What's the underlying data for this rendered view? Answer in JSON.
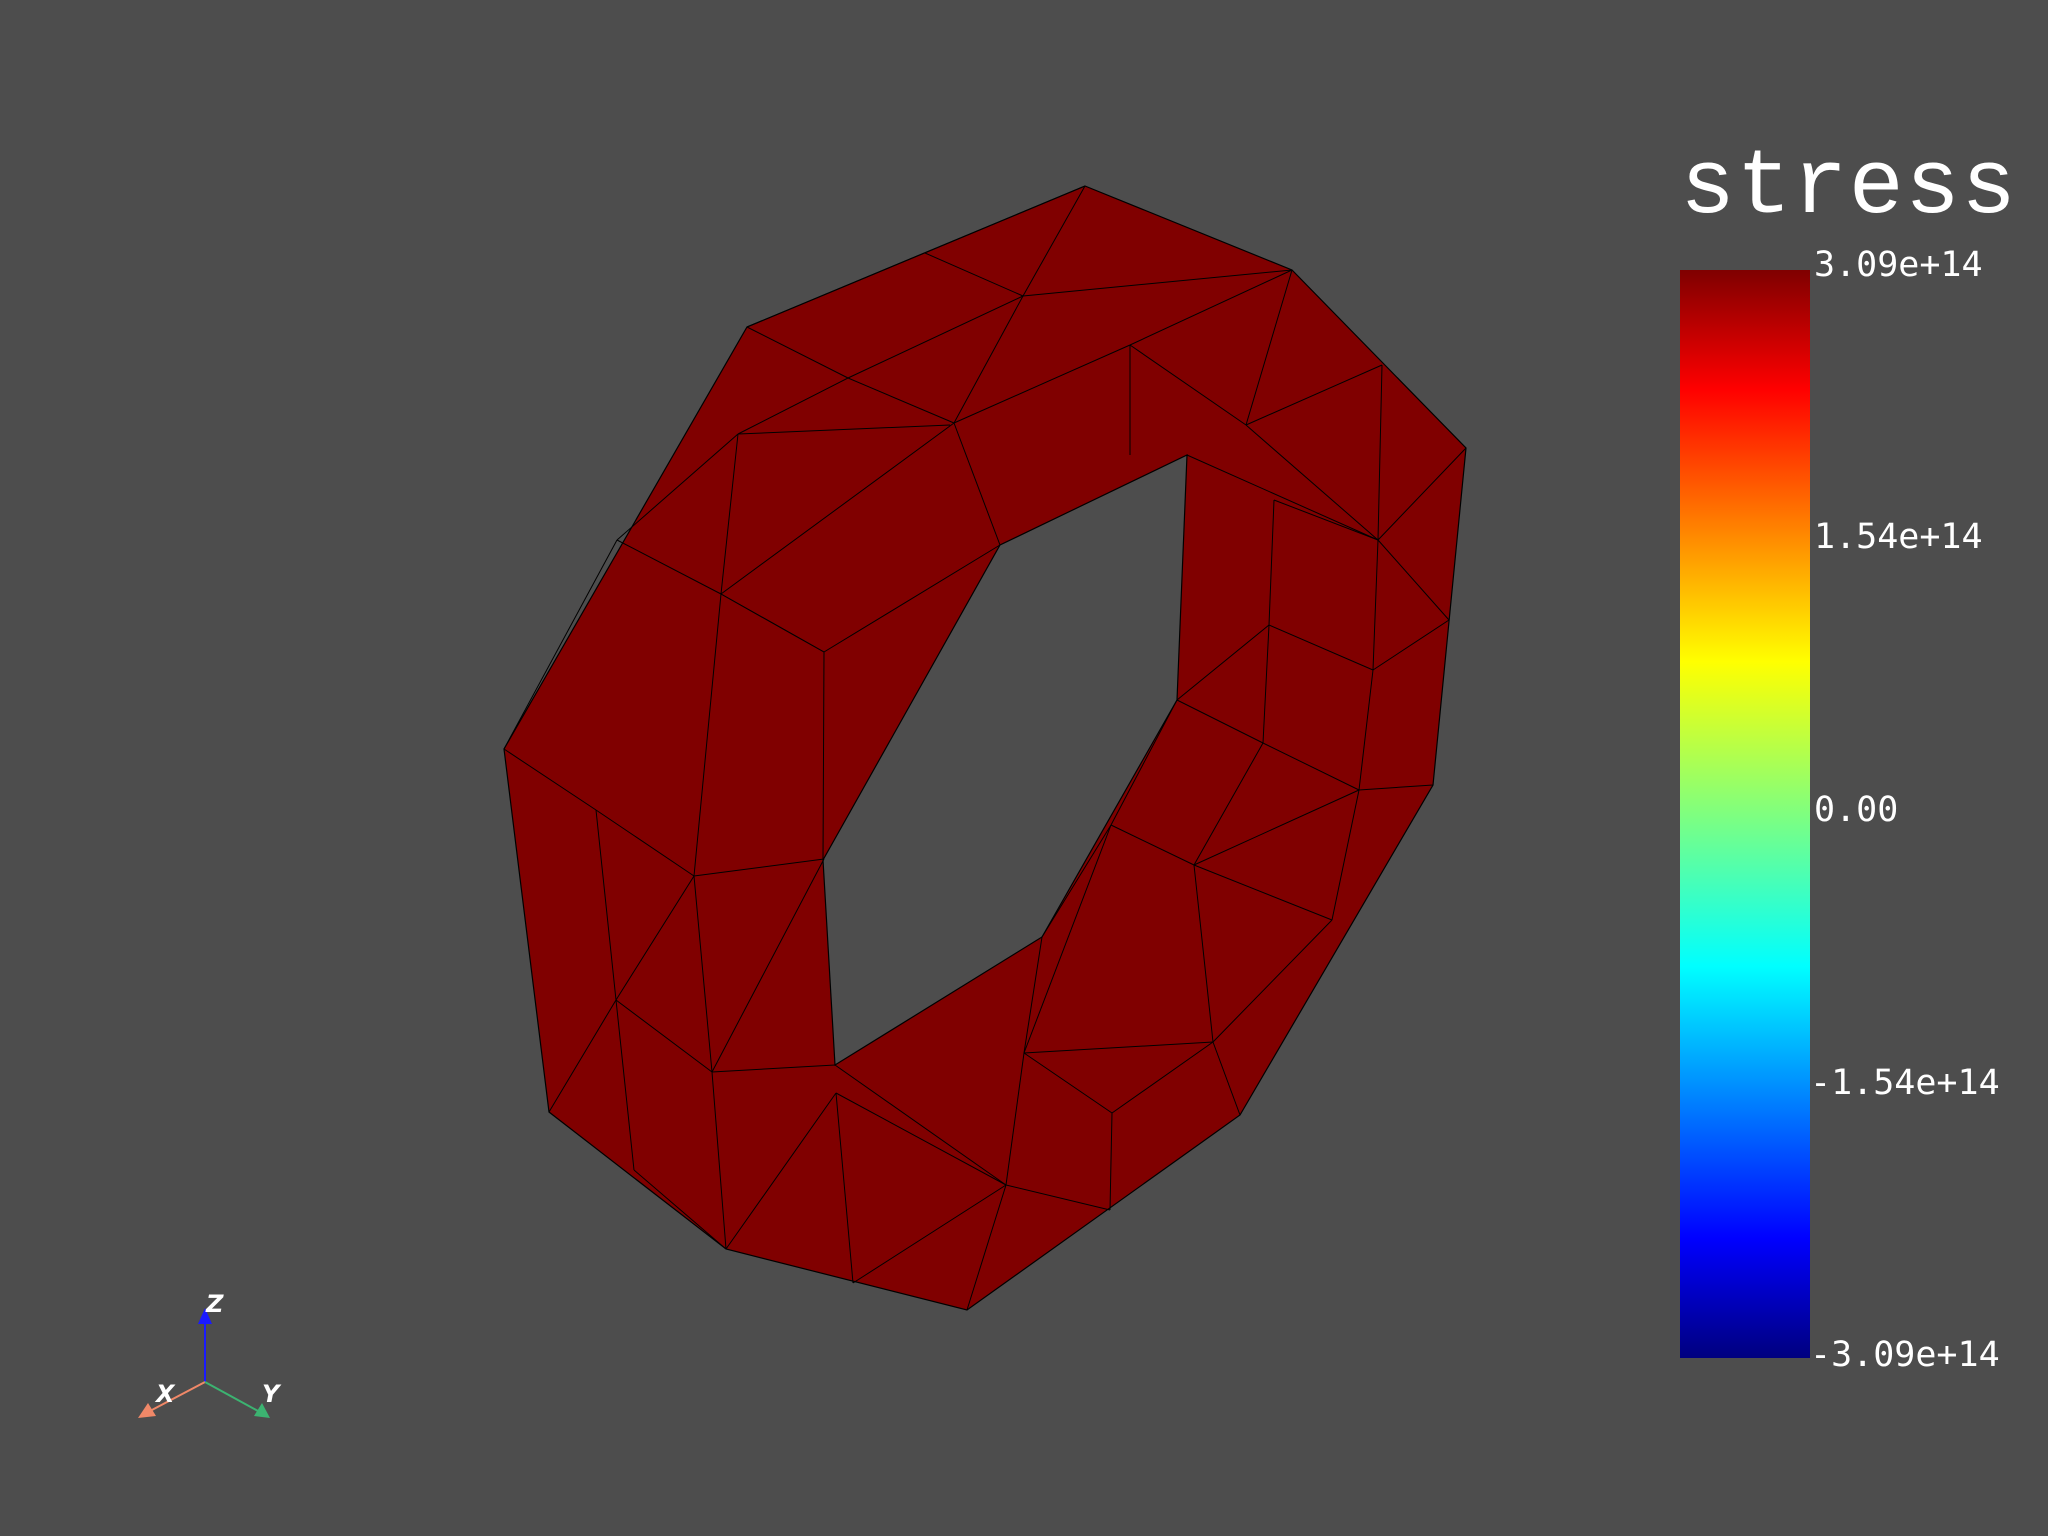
{
  "scalar_bar": {
    "title": "stress",
    "ticks": [
      "3.09e+14",
      "1.54e+14",
      "0.00",
      "-1.54e+14",
      "-3.09e+14"
    ],
    "colormap": "jet",
    "range": [
      -309000000000000.0,
      309000000000000.0
    ]
  },
  "mesh": {
    "shape": "ring",
    "element": "triangle",
    "face_color": "#800000",
    "edge_color": "#000000"
  },
  "orientation_axes": {
    "labels": {
      "x": "X",
      "y": "Y",
      "z": "Z"
    },
    "colors": {
      "x": "#f08868",
      "y": "#3cb371",
      "z": "#1a1aff"
    }
  },
  "background": "#4d4d4d"
}
